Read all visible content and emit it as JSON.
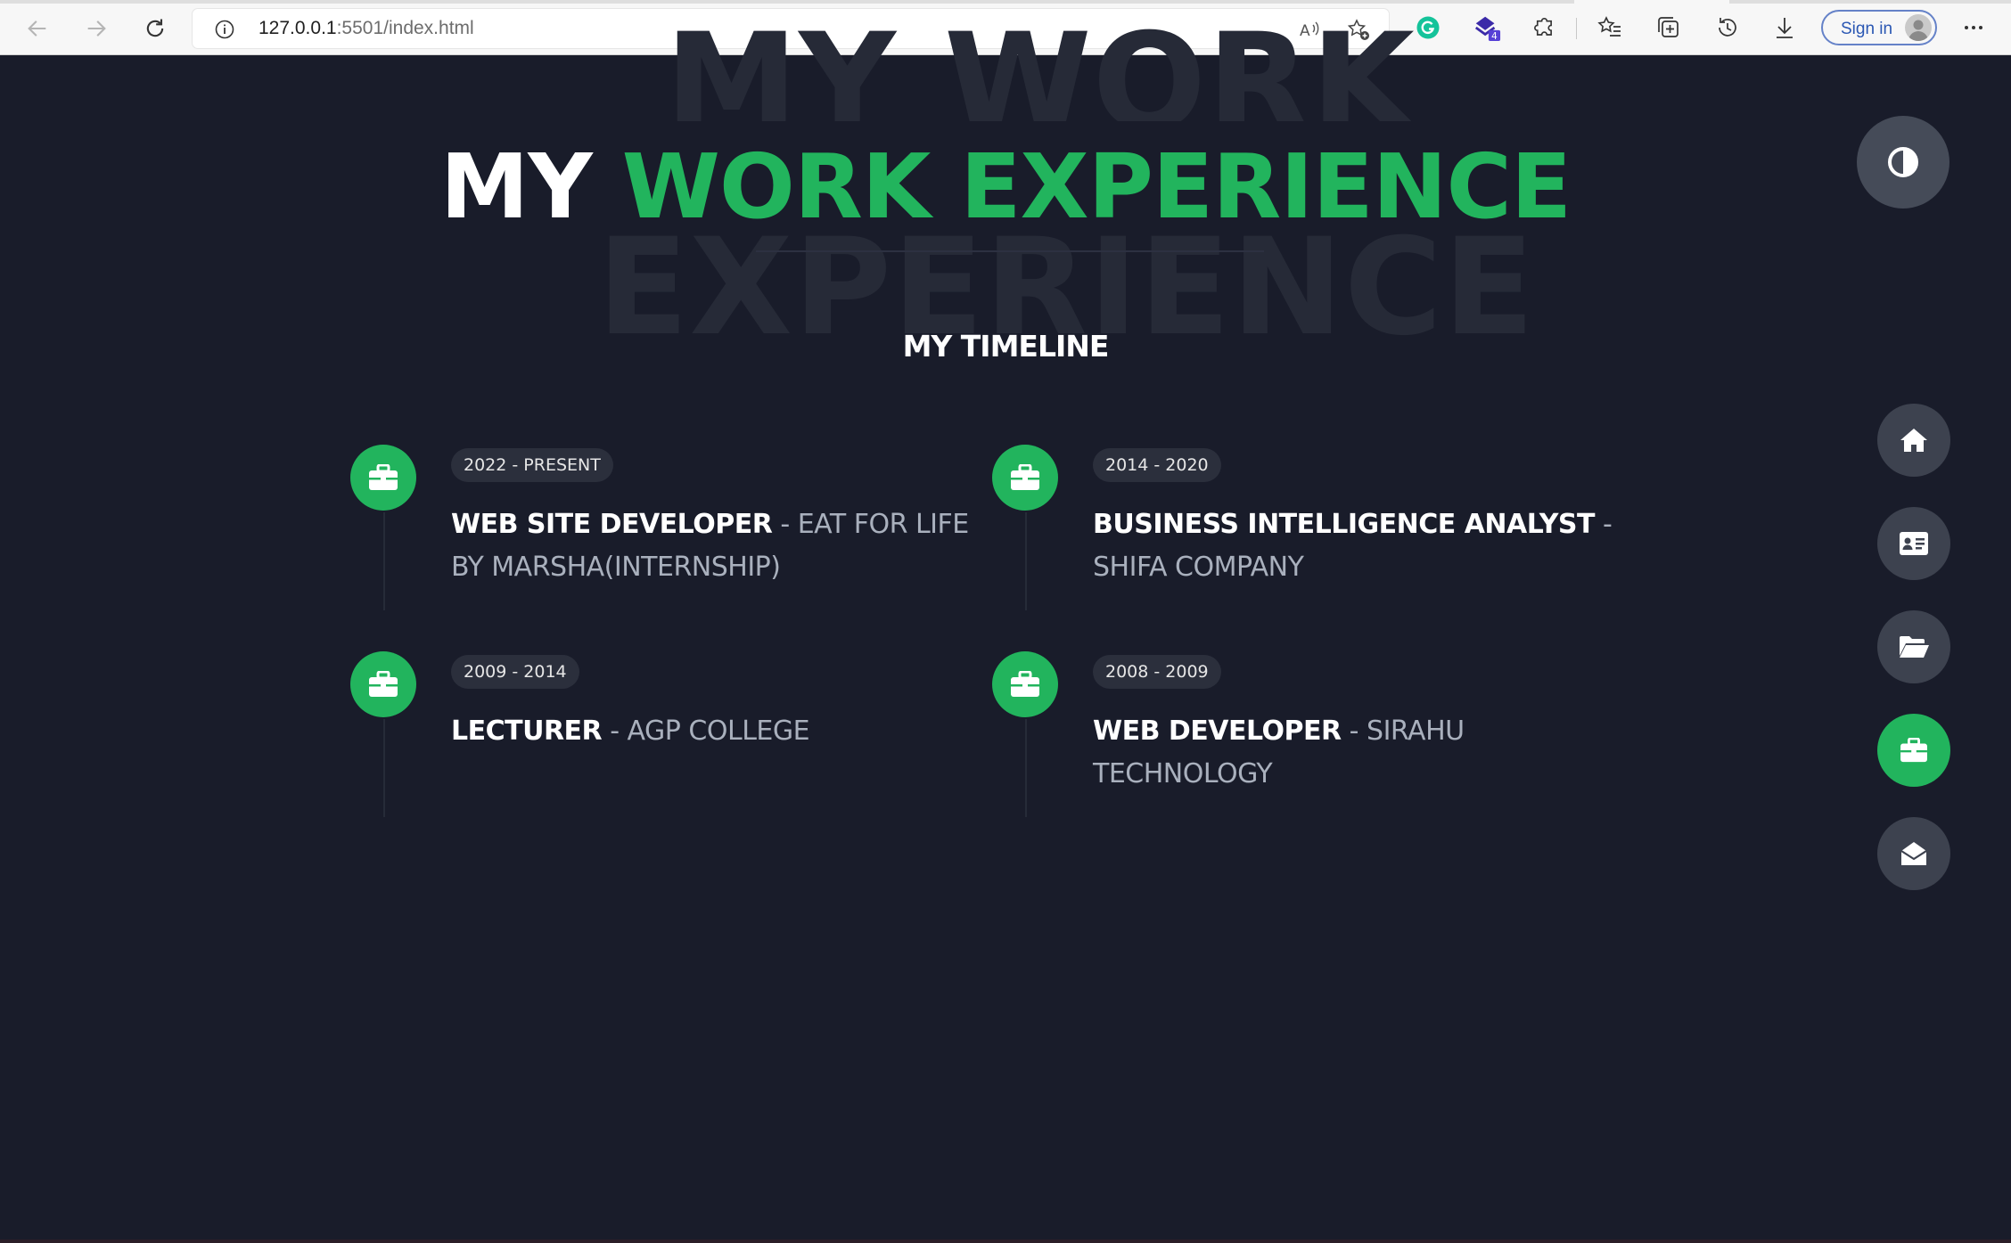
{
  "browser": {
    "url_host": "127.0.0.1",
    "url_path": ":5501/index.html",
    "signin_label": "Sign in",
    "extension_badge": "4"
  },
  "page": {
    "background_text_top": "MY WORK",
    "background_text_bottom": "EXPERIENCE",
    "heading_prefix": "MY",
    "heading_accent": "WORK EXPERIENCE",
    "subheading": "MY TIMELINE",
    "accent_color": "#22b45d"
  },
  "timeline": [
    {
      "period": "2022 - PRESENT",
      "role": "WEB SITE DEVELOPER",
      "org": " - EAT FOR LIFE BY MARSHA(INTERNSHIP)"
    },
    {
      "period": "2014 - 2020",
      "role": "BUSINESS INTELLIGENCE ANALYST",
      "org": " - SHIFA COMPANY"
    },
    {
      "period": "2009 - 2014",
      "role": "LECTURER",
      "org": " - AGP COLLEGE"
    },
    {
      "period": "2008 - 2009",
      "role": "WEB DEVELOPER",
      "org": " - SIRAHU TECHNOLOGY"
    }
  ],
  "sidebar": {
    "items": [
      {
        "icon": "home-icon",
        "active": false
      },
      {
        "icon": "contact-card-icon",
        "active": false
      },
      {
        "icon": "folder-open-icon",
        "active": false
      },
      {
        "icon": "briefcase-icon",
        "active": true
      },
      {
        "icon": "envelope-open-icon",
        "active": false
      }
    ]
  }
}
